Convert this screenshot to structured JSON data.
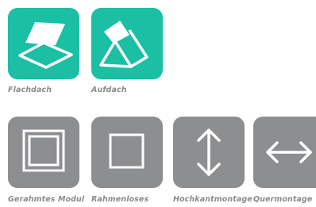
{
  "colors": {
    "teal": "#1bbfa3",
    "grey": "#8d8e90",
    "label": "#8a8a8a"
  },
  "roof_types": [
    {
      "label": "Flachdach",
      "icon": "flat-roof-icon",
      "selected": true
    },
    {
      "label": "Aufdach",
      "icon": "pitched-roof-icon",
      "selected": true
    }
  ],
  "module_options": [
    {
      "label": "Gerahmtes Modul",
      "icon": "framed-module-icon"
    },
    {
      "label": "Rahmenloses",
      "icon": "frameless-module-icon"
    },
    {
      "label": "Hochkantmontage",
      "icon": "vertical-arrow-icon"
    },
    {
      "label": "Quermontage",
      "icon": "horizontal-arrow-icon"
    }
  ]
}
